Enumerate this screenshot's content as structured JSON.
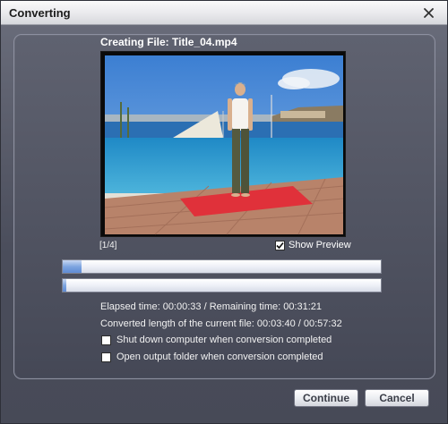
{
  "window": {
    "title": "Converting"
  },
  "header": {
    "creating_file": "Creating File: Title_04.mp4"
  },
  "preview": {
    "counter": "[1/4]",
    "show_preview_label": "Show Preview",
    "show_preview_checked": true
  },
  "progress": {
    "file_progress": 0.06,
    "overall_progress": 0.01
  },
  "info": {
    "elapsed_line": "Elapsed time:  00:00:33  / Remaining time:  00:31:21",
    "converted_line": "Converted length of the current file:  00:03:40 / 00:57:32"
  },
  "options": {
    "shutdown_label": "Shut down computer when conversion completed",
    "open_folder_label": "Open output folder when conversion completed"
  },
  "buttons": {
    "continue": "Continue",
    "cancel": "Cancel"
  }
}
